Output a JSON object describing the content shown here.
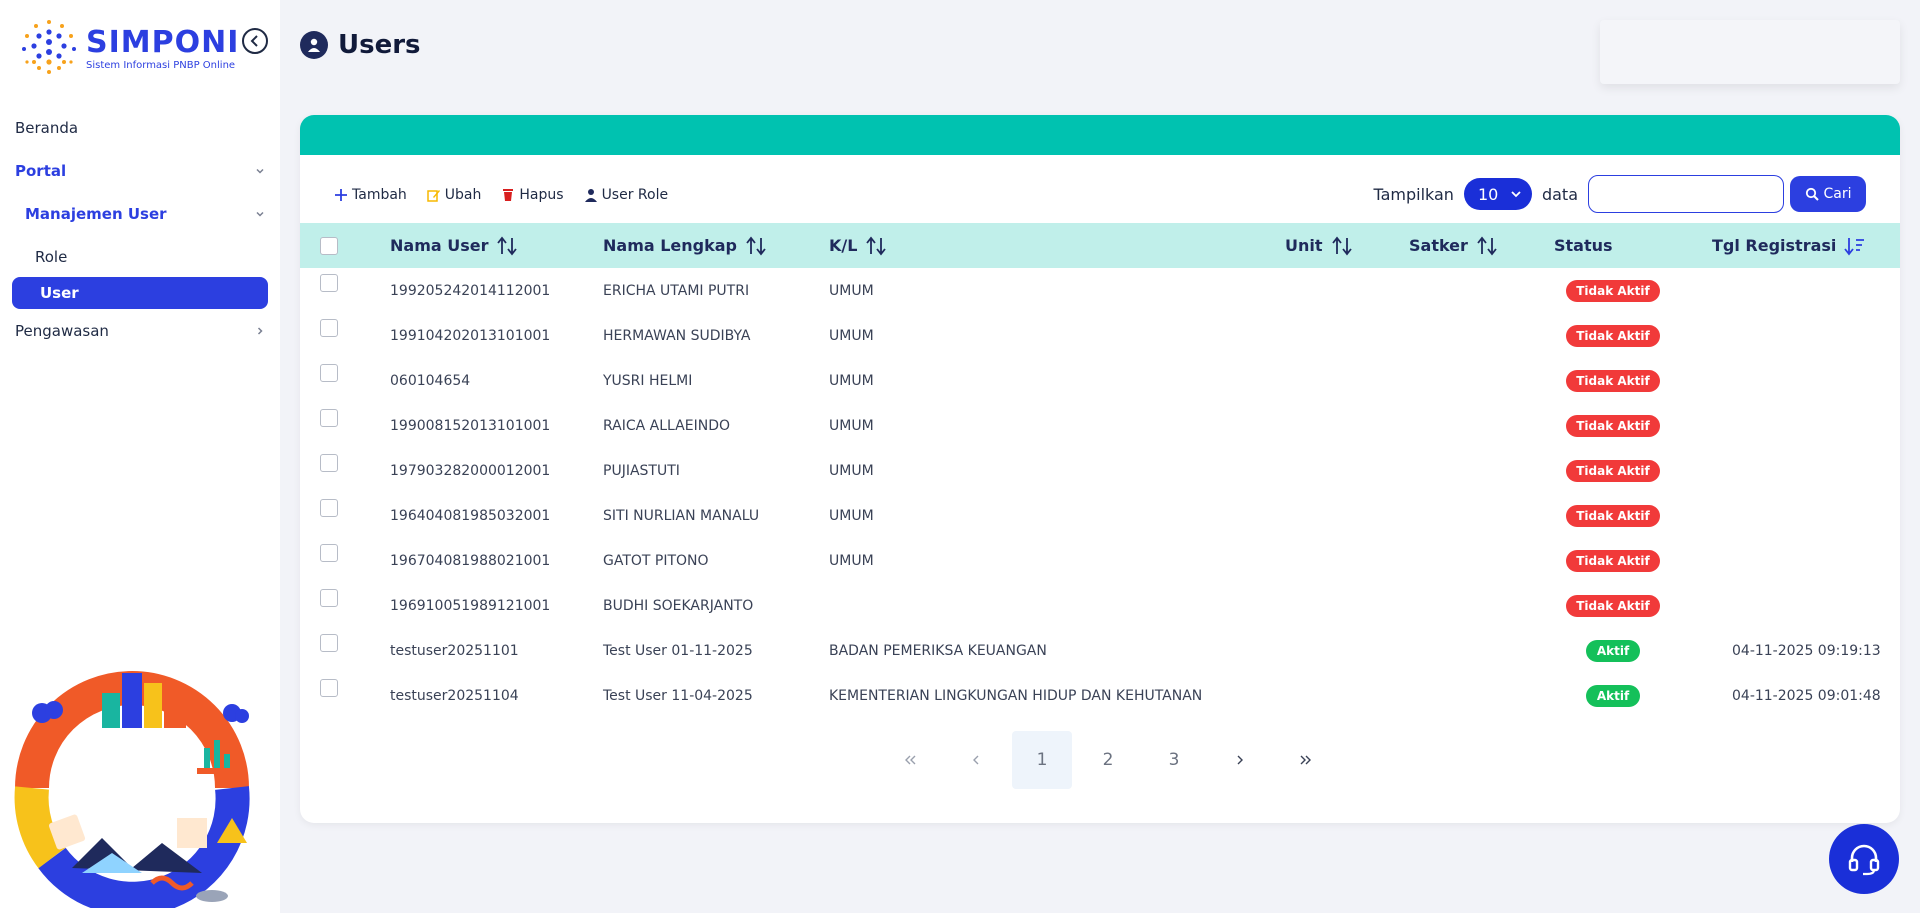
{
  "brand": {
    "title": "SIMPONI",
    "subtitle": "Sistem Informasi PNBP Online",
    "color": "#2c3fe0"
  },
  "sidebar": {
    "items": [
      {
        "label": "Beranda"
      },
      {
        "label": "Portal"
      },
      {
        "label": "Manajemen User"
      },
      {
        "label": "Role"
      },
      {
        "label": "User"
      },
      {
        "label": "Pengawasan"
      }
    ]
  },
  "header": {
    "title": "Users"
  },
  "toolbar": {
    "add": "Tambah",
    "edit": "Ubah",
    "delete": "Hapus",
    "user_role": "User Role"
  },
  "controls": {
    "show_label": "Tampilkan",
    "page_size": "10",
    "data_label": "data",
    "search_placeholder": "",
    "search_button": "Cari"
  },
  "table": {
    "columns": [
      "Nama User",
      "Nama Lengkap",
      "K/L",
      "Unit",
      "Satker",
      "Status",
      "Tgl Registrasi"
    ],
    "rows": [
      {
        "user": "199205242014112001",
        "name": "ERICHA UTAMI PUTRI",
        "kl": "UMUM",
        "unit": "",
        "satker": "",
        "status": "Tidak Aktif",
        "active": false,
        "date": ""
      },
      {
        "user": "199104202013101001",
        "name": "HERMAWAN SUDIBYA",
        "kl": "UMUM",
        "unit": "",
        "satker": "",
        "status": "Tidak Aktif",
        "active": false,
        "date": ""
      },
      {
        "user": "060104654",
        "name": "YUSRI HELMI",
        "kl": "UMUM",
        "unit": "",
        "satker": "",
        "status": "Tidak Aktif",
        "active": false,
        "date": ""
      },
      {
        "user": "199008152013101001",
        "name": "RAICA ALLAEINDO",
        "kl": "UMUM",
        "unit": "",
        "satker": "",
        "status": "Tidak Aktif",
        "active": false,
        "date": ""
      },
      {
        "user": "197903282000012001",
        "name": "PUJIASTUTI",
        "kl": "UMUM",
        "unit": "",
        "satker": "",
        "status": "Tidak Aktif",
        "active": false,
        "date": ""
      },
      {
        "user": "196404081985032001",
        "name": "SITI NURLIAN MANALU",
        "kl": "UMUM",
        "unit": "",
        "satker": "",
        "status": "Tidak Aktif",
        "active": false,
        "date": ""
      },
      {
        "user": "196704081988021001",
        "name": "GATOT PITONO",
        "kl": "UMUM",
        "unit": "",
        "satker": "",
        "status": "Tidak Aktif",
        "active": false,
        "date": ""
      },
      {
        "user": "196910051989121001",
        "name": "BUDHI SOEKARJANTO",
        "kl": "",
        "unit": "",
        "satker": "",
        "status": "Tidak Aktif",
        "active": false,
        "date": ""
      },
      {
        "user": "testuser20251101",
        "name": "Test User 01-11-2025",
        "kl": "BADAN PEMERIKSA KEUANGAN",
        "unit": "",
        "satker": "",
        "status": "Aktif",
        "active": true,
        "date": "04-11-2025 09:19:13"
      },
      {
        "user": "testuser20251104",
        "name": "Test User 11-04-2025",
        "kl": "KEMENTERIAN LINGKUNGAN HIDUP DAN KEHUTANAN",
        "unit": "",
        "satker": "",
        "status": "Aktif",
        "active": true,
        "date": "04-11-2025 09:01:48"
      }
    ]
  },
  "pagination": {
    "pages": [
      "1",
      "2",
      "3"
    ],
    "current": "1"
  },
  "colors": {
    "accent": "#2c3fe0",
    "band": "#00c2b0",
    "header_row": "#c0efea",
    "inactive": "#f13a3a",
    "active": "#14c05a"
  }
}
